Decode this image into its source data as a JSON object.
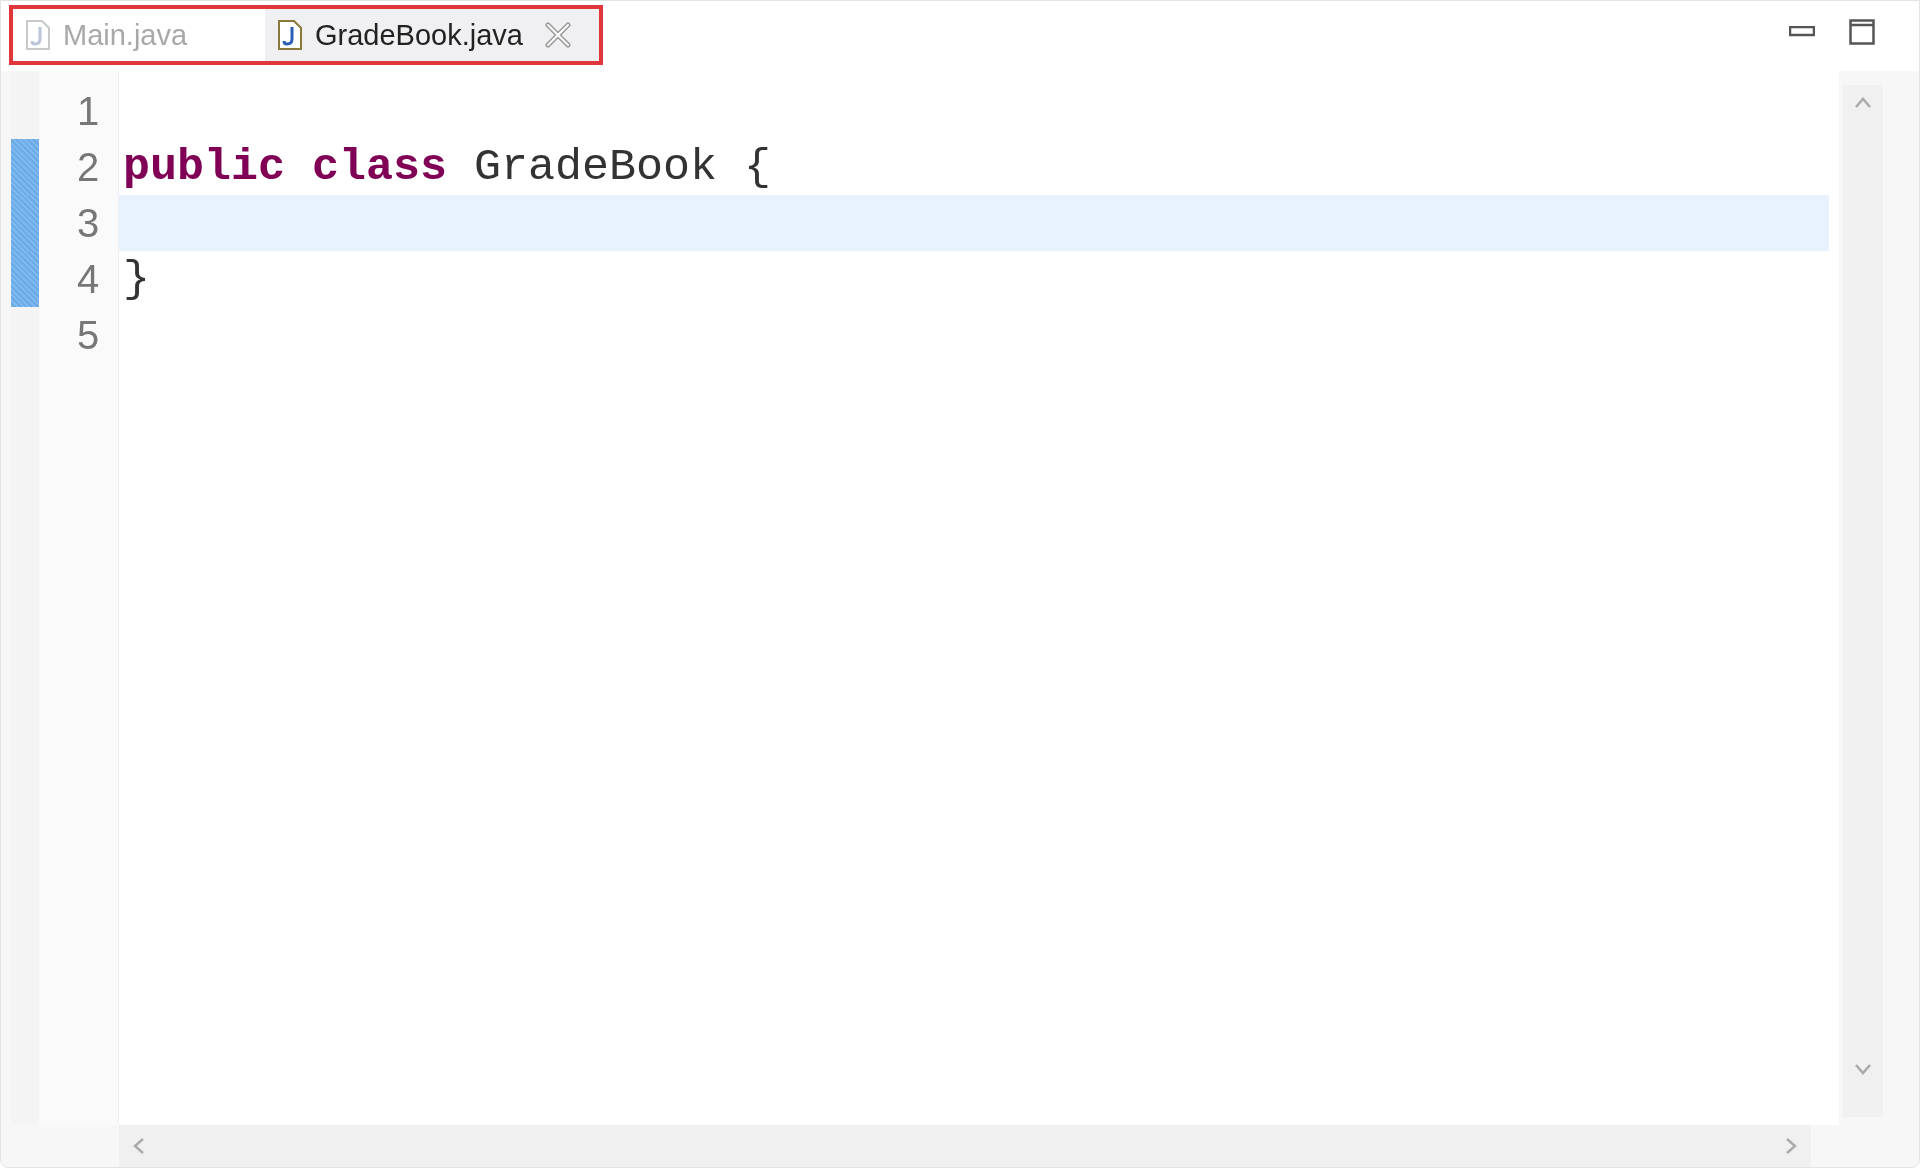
{
  "tabs_highlighted": true,
  "tabs": [
    {
      "label": "Main.java",
      "selected": false
    },
    {
      "label": "GradeBook.java",
      "selected": true
    }
  ],
  "lines": [
    {
      "number": "1",
      "changed": false,
      "current": false
    },
    {
      "number": "2",
      "changed": true,
      "current": false,
      "tokens": [
        {
          "kind": "keyword",
          "text": "public class"
        },
        {
          "kind": "plain",
          "text": " GradeBook {"
        }
      ]
    },
    {
      "number": "3",
      "changed": true,
      "current": true
    },
    {
      "number": "4",
      "changed": true,
      "current": false,
      "tokens": [
        {
          "kind": "plain",
          "text": "}"
        }
      ]
    },
    {
      "number": "5",
      "changed": false,
      "current": false
    }
  ]
}
